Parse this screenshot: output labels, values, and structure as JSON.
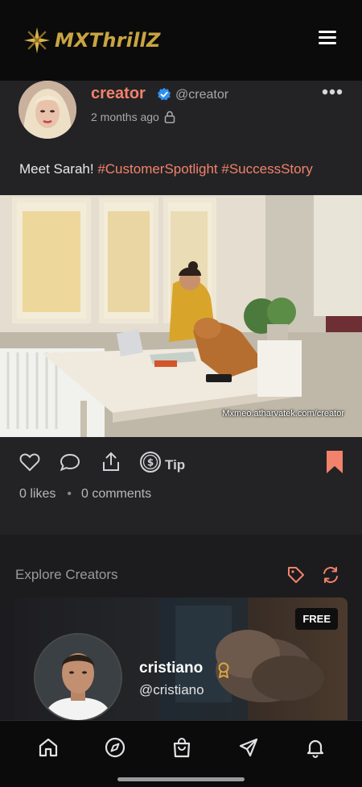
{
  "header": {
    "brand": "MXThrillZ",
    "logo_icon": "star-logo-icon",
    "menu_icon": "hamburger-menu-icon",
    "brand_color": "#c9a441"
  },
  "post": {
    "creator_name": "creator",
    "handle": "@creator",
    "timestamp": "2 months ago",
    "caption_text": "Meet Sarah! ",
    "hashtags": [
      "#CustomerSpotlight",
      "#SuccessStory"
    ],
    "watermark": "Mxmeo.atharvatek.com/creator",
    "tip_label": "Tip",
    "likes_text": "0 likes",
    "comments_text": "0 comments",
    "accent_color": "#f2826b"
  },
  "explore": {
    "title": "Explore Creators",
    "creator_card": {
      "badge": "FREE",
      "name": "cristiano",
      "handle": "@cristiano"
    }
  },
  "bottom_nav": {
    "items": [
      "home-icon",
      "compass-icon",
      "shopping-bag-icon",
      "send-icon",
      "bell-icon"
    ]
  }
}
